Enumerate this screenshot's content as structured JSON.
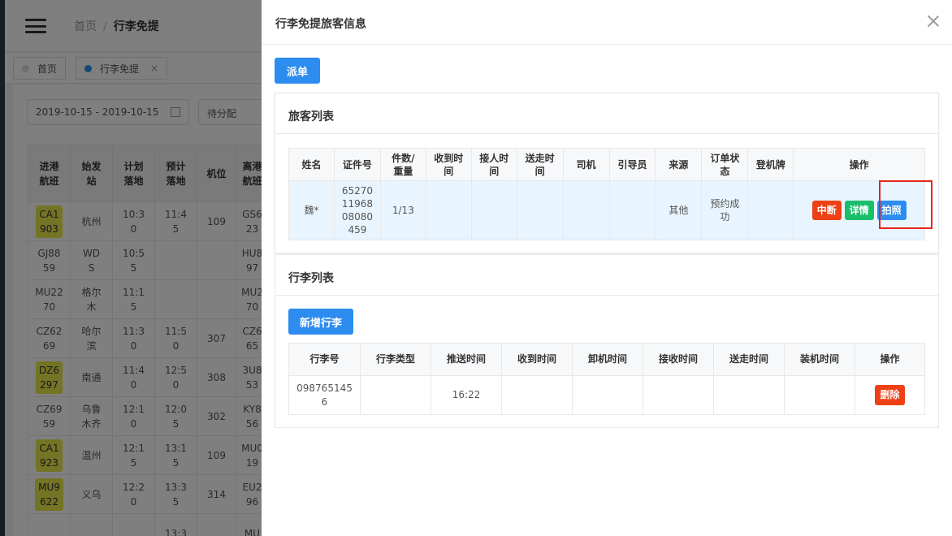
{
  "app": {
    "breadcrumb": [
      "首页",
      "行李免提"
    ],
    "tabs": [
      {
        "label": "首页",
        "active": false,
        "dot_color": "#dcdcdc"
      },
      {
        "label": "行李免提",
        "active": true,
        "dot_color": "#2d8cf0",
        "close": "×"
      }
    ],
    "filters": {
      "date_range": "2019-10-15 - 2019-10-15",
      "status": "待分配"
    },
    "flight_table": {
      "headers": [
        "进港航班",
        "始发站",
        "计划落地",
        "预计落地",
        "机位",
        "离港航班"
      ],
      "rows": [
        [
          "CA1903",
          "杭州",
          "10:30",
          "11:45",
          "109",
          "GS623"
        ],
        [
          "GJ8859",
          "WDS",
          "10:55",
          "",
          "",
          "HU897"
        ],
        [
          "MU2270",
          "格尔木",
          "11:15",
          "",
          "",
          "MU270"
        ],
        [
          "CZ6269",
          "哈尔滨",
          "11:30",
          "11:50",
          "307",
          "CZ665"
        ],
        [
          "DZ6297",
          "南通",
          "11:40",
          "12:50",
          "308",
          "3U853"
        ],
        [
          "CZ6959",
          "乌鲁木齐",
          "12:10",
          "12:05",
          "302",
          "KY856"
        ],
        [
          "CA1923",
          "温州",
          "12:15",
          "13:15",
          "109",
          "MU019"
        ],
        [
          "MU9622",
          "义乌",
          "12:20",
          "13:35",
          "314",
          "EU296"
        ],
        [
          "",
          "",
          "",
          "13:3",
          "",
          "MU"
        ]
      ],
      "highlighted_flights": [
        0,
        4,
        6,
        7
      ]
    }
  },
  "drawer": {
    "title": "行李免提旅客信息",
    "dispatch_label": "派单",
    "passenger_section": {
      "title": "旅客列表",
      "headers": [
        "姓名",
        "证件号",
        "件数/重量",
        "收到时间",
        "接人时间",
        "送走时间",
        "司机",
        "引导员",
        "来源",
        "订单状态",
        "登机牌",
        "操作"
      ],
      "rows": [
        {
          "name": "魏*",
          "id_number": "652701196808080459",
          "count_weight": "1/13",
          "received": "",
          "pickup": "",
          "sent": "",
          "driver": "",
          "guide": "",
          "source": "其他",
          "status": "预约成功",
          "boarding": ""
        }
      ],
      "actions": {
        "interrupt": "中断",
        "detail": "详情",
        "photo": "拍照"
      }
    },
    "baggage_section": {
      "title": "行李列表",
      "add_label": "新增行李",
      "headers": [
        "行李号",
        "行李类型",
        "推送时间",
        "收到时间",
        "卸机时间",
        "接收时间",
        "送走时间",
        "装机时间",
        "操作"
      ],
      "rows": [
        {
          "bag_no": "0987651456",
          "type": "",
          "push_time": "16:22",
          "received": "",
          "unload": "",
          "accept": "",
          "sent": "",
          "load": ""
        }
      ],
      "delete_label": "删除"
    }
  }
}
